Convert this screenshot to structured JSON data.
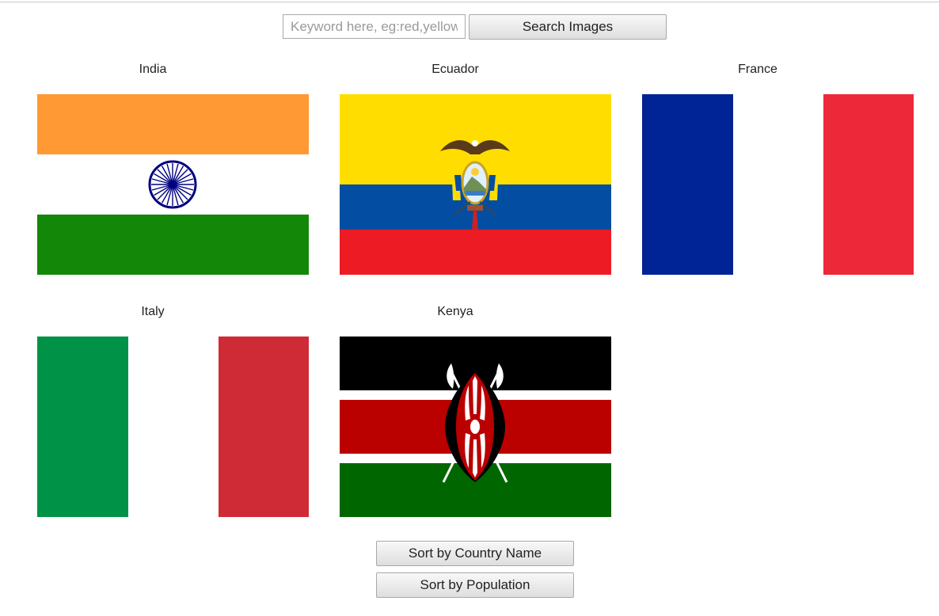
{
  "search": {
    "placeholder": "Keyword here, eg:red,yellow",
    "value": "",
    "button_label": "Search Images"
  },
  "flags": [
    {
      "name": "India",
      "icon": "india-flag"
    },
    {
      "name": "Ecuador",
      "icon": "ecuador-flag"
    },
    {
      "name": "France",
      "icon": "france-flag"
    },
    {
      "name": "Italy",
      "icon": "italy-flag"
    },
    {
      "name": "Kenya",
      "icon": "kenya-flag"
    }
  ],
  "sort": {
    "by_name_label": "Sort by Country Name",
    "by_population_label": "Sort by Population"
  },
  "colors": {
    "india_saffron": "#ff9933",
    "india_green": "#138808",
    "india_chakra": "#000080",
    "ecuador_yellow": "#ffdd00",
    "ecuador_blue": "#034ea2",
    "ecuador_red": "#ed1c24",
    "france_blue": "#002395",
    "france_red": "#ed2939",
    "italy_green": "#009246",
    "italy_red": "#ce2b37",
    "kenya_black": "#000000",
    "kenya_red": "#bb0000",
    "kenya_green": "#006600"
  }
}
